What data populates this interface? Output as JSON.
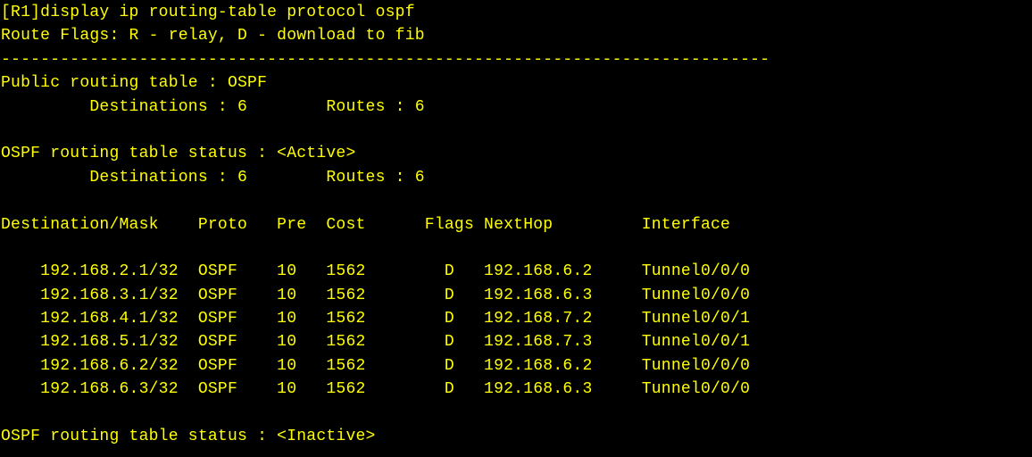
{
  "terminal": {
    "text_color": "#ffff00",
    "background_color": "#000000",
    "command": "[R1]display ip routing-table protocol ospf",
    "route_flags": "Route Flags: R - relay, D - download to fib",
    "separator": "------------------------------------------------------------------------------",
    "public_table_header": "Public routing table : OSPF",
    "public_summary": "         Destinations : 6        Routes : 6",
    "active_status": "OSPF routing table status : <Active>",
    "active_summary": "         Destinations : 6        Routes : 6",
    "column_header": "Destination/Mask    Proto   Pre  Cost      Flags NextHop         Interface",
    "routes": [
      "    192.168.2.1/32  OSPF    10   1562        D   192.168.6.2     Tunnel0/0/0",
      "    192.168.3.1/32  OSPF    10   1562        D   192.168.6.3     Tunnel0/0/0",
      "    192.168.4.1/32  OSPF    10   1562        D   192.168.7.2     Tunnel0/0/1",
      "    192.168.5.1/32  OSPF    10   1562        D   192.168.7.3     Tunnel0/0/1",
      "    192.168.6.2/32  OSPF    10   1562        D   192.168.6.2     Tunnel0/0/0",
      "    192.168.6.3/32  OSPF    10   1562        D   192.168.6.3     Tunnel0/0/0"
    ],
    "inactive_status": "OSPF routing table status : <Inactive>"
  }
}
